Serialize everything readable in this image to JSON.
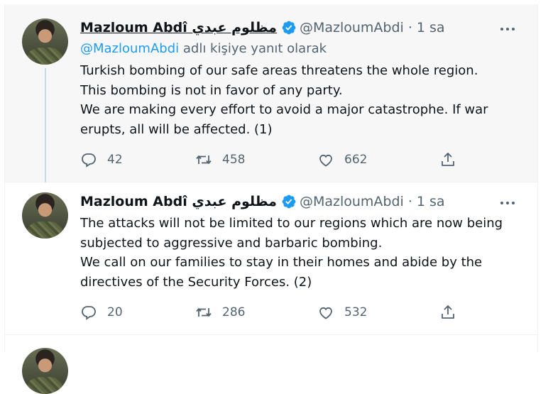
{
  "tweets": [
    {
      "name": "Mazloum Abdî مظلوم عبدي",
      "handle": "@MazloumAbdi",
      "separator": "·",
      "time": "1 sa",
      "reply_mention": "@MazloumAbdi",
      "reply_suffix": " adlı kişiye yanıt olarak",
      "lines": [
        "Turkish bombing of our safe areas threatens the whole region.",
        "This bombing is not in favor of any party.",
        "We are making every effort to avoid a major catastrophe. If war",
        "erupts, all will be affected. (1)"
      ],
      "replies": "42",
      "retweets": "458",
      "likes": "662"
    },
    {
      "name": "Mazloum Abdî مظلوم عبدي",
      "handle": "@MazloumAbdi",
      "separator": "·",
      "time": "1 sa",
      "lines": [
        "The attacks will not be limited to our regions which are now being",
        "subjected to aggressive and barbaric bombing.",
        "We call on our families to stay in their homes and abide by the",
        "directives of the Security Forces. (2)"
      ],
      "replies": "20",
      "retweets": "286",
      "likes": "532"
    }
  ],
  "colors": {
    "verified": "#1d9bf0",
    "muted": "#536471",
    "text": "#0f1419",
    "highlight_bg": "#f7f7f7"
  },
  "icons": [
    "avatar",
    "verified-badge-icon",
    "more-icon",
    "reply-icon",
    "retweet-icon",
    "like-icon",
    "share-icon"
  ]
}
